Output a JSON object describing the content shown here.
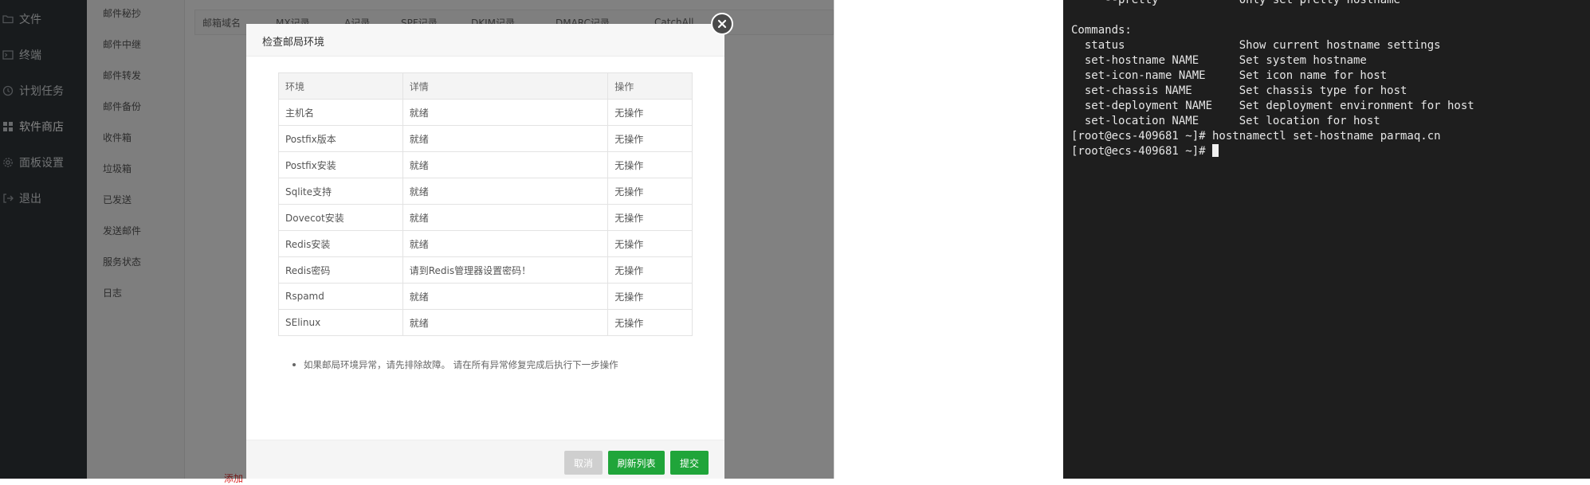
{
  "left_sidebar": {
    "items": [
      {
        "label": "文件",
        "icon": "folder-icon"
      },
      {
        "label": "终端",
        "icon": "terminal-icon"
      },
      {
        "label": "计划任务",
        "icon": "clock-icon"
      },
      {
        "label": "软件商店",
        "icon": "grid-icon"
      },
      {
        "label": "面板设置",
        "icon": "gear-icon"
      },
      {
        "label": "退出",
        "icon": "logout-icon"
      }
    ]
  },
  "mail_sidebar": {
    "items": [
      "邮件秘抄",
      "邮件中继",
      "邮件转发",
      "邮件备份",
      "收件箱",
      "垃圾箱",
      "已发送",
      "发送邮件",
      "服务状态",
      "日志"
    ]
  },
  "domain_table": {
    "headers": [
      "邮箱域名",
      "MX记录",
      "A记录",
      "SPF记录",
      "DKIM记录",
      "DMARC记录",
      "CatchAll"
    ]
  },
  "modal": {
    "title": "检查邮局环境",
    "table": {
      "headers": {
        "env": "环境",
        "detail": "详情",
        "op": "操作"
      },
      "rows": [
        {
          "env": "主机名",
          "detail": "就绪",
          "op": "无操作",
          "status": "ok"
        },
        {
          "env": "Postfix版本",
          "detail": "就绪",
          "op": "无操作",
          "status": "ok"
        },
        {
          "env": "Postfix安装",
          "detail": "就绪",
          "op": "无操作",
          "status": "ok"
        },
        {
          "env": "Sqlite支持",
          "detail": "就绪",
          "op": "无操作",
          "status": "ok"
        },
        {
          "env": "Dovecot安装",
          "detail": "就绪",
          "op": "无操作",
          "status": "ok"
        },
        {
          "env": "Redis安装",
          "detail": "就绪",
          "op": "无操作",
          "status": "ok"
        },
        {
          "env": "Redis密码",
          "detail": "请到Redis管理器设置密码！",
          "op": "无操作",
          "status": "error"
        },
        {
          "env": "Rspamd",
          "detail": "就绪",
          "op": "无操作",
          "status": "ok"
        },
        {
          "env": "SElinux",
          "detail": "就绪",
          "op": "无操作",
          "status": "ok"
        }
      ]
    },
    "note": "如果邮局环境异常，请先排除故障。 请在所有异常修复完成后执行下一步操作",
    "buttons": {
      "cancel": "取消",
      "refresh": "刷新列表",
      "submit": "提交"
    }
  },
  "page_hint": "添加",
  "terminal": {
    "lines": [
      "     --pretty            Only set pretty hostname",
      "",
      "Commands:",
      "  status                 Show current hostname settings",
      "  set-hostname NAME      Set system hostname",
      "  set-icon-name NAME     Set icon name for host",
      "  set-chassis NAME       Set chassis type for host",
      "  set-deployment NAME    Set deployment environment for host",
      "  set-location NAME      Set location for host",
      "[root@ecs-409681 ~]# hostnamectl set-hostname parmaq.cn"
    ],
    "prompt": "[root@ecs-409681 ~]# "
  },
  "colors": {
    "accent": "#20a53a",
    "error": "#ff2a2a",
    "sidebar": "#2f3438",
    "terminal_bg": "#1e1e1e"
  }
}
